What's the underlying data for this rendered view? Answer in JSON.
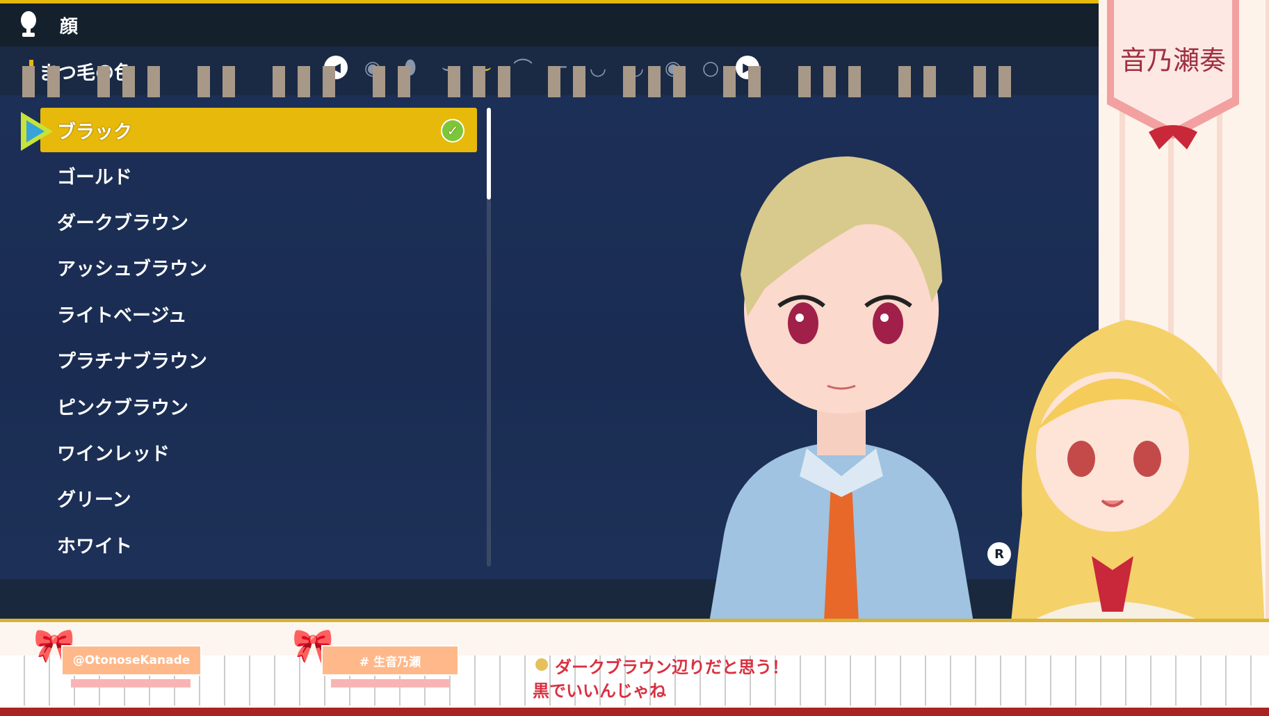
{
  "header": {
    "title": "顔",
    "icon": "face-silhouette-icon"
  },
  "subheader": {
    "title": "まつ毛の色",
    "accent": "#e5b80b"
  },
  "category_icons": [
    {
      "name": "prev-arrow-icon",
      "glyph": "◀"
    },
    {
      "name": "eye-icon",
      "glyph": "◉"
    },
    {
      "name": "contact-lens-icon",
      "glyph": "⬮"
    },
    {
      "name": "eyelash-closed-icon",
      "glyph": "⌣"
    },
    {
      "name": "eyelash-color-icon",
      "glyph": "⌣"
    },
    {
      "name": "eyebrow-icon",
      "glyph": "⌒"
    },
    {
      "name": "eyebrow-color-icon",
      "glyph": "⌐"
    },
    {
      "name": "lips-icon",
      "glyph": "◡"
    },
    {
      "name": "lipstick-icon",
      "glyph": "◡"
    },
    {
      "name": "mole-icon",
      "glyph": "◉"
    },
    {
      "name": "face-blush-icon",
      "glyph": "○"
    },
    {
      "name": "next-arrow-icon",
      "glyph": "▶"
    }
  ],
  "color_options": [
    {
      "label": "ブラック",
      "selected": true
    },
    {
      "label": "ゴールド"
    },
    {
      "label": "ダークブラウン"
    },
    {
      "label": "アッシュブラウン"
    },
    {
      "label": "ライトベージュ"
    },
    {
      "label": "プラチナブラウン"
    },
    {
      "label": "ピンクブラウン"
    },
    {
      "label": "ワインレッド"
    },
    {
      "label": "グリーン"
    },
    {
      "label": "ホワイト"
    }
  ],
  "controls": {
    "rotate_button": "R",
    "rotate_icon": "rotate-camera-icon"
  },
  "stream_overlay": {
    "handle": "@OtonoseKanade",
    "hashtag": "# 生音乃瀬",
    "logo_text": "音乃瀬奏",
    "chat": [
      "ダークブラウン辺りだと思う！",
      "黒でいいんじゃね"
    ]
  }
}
